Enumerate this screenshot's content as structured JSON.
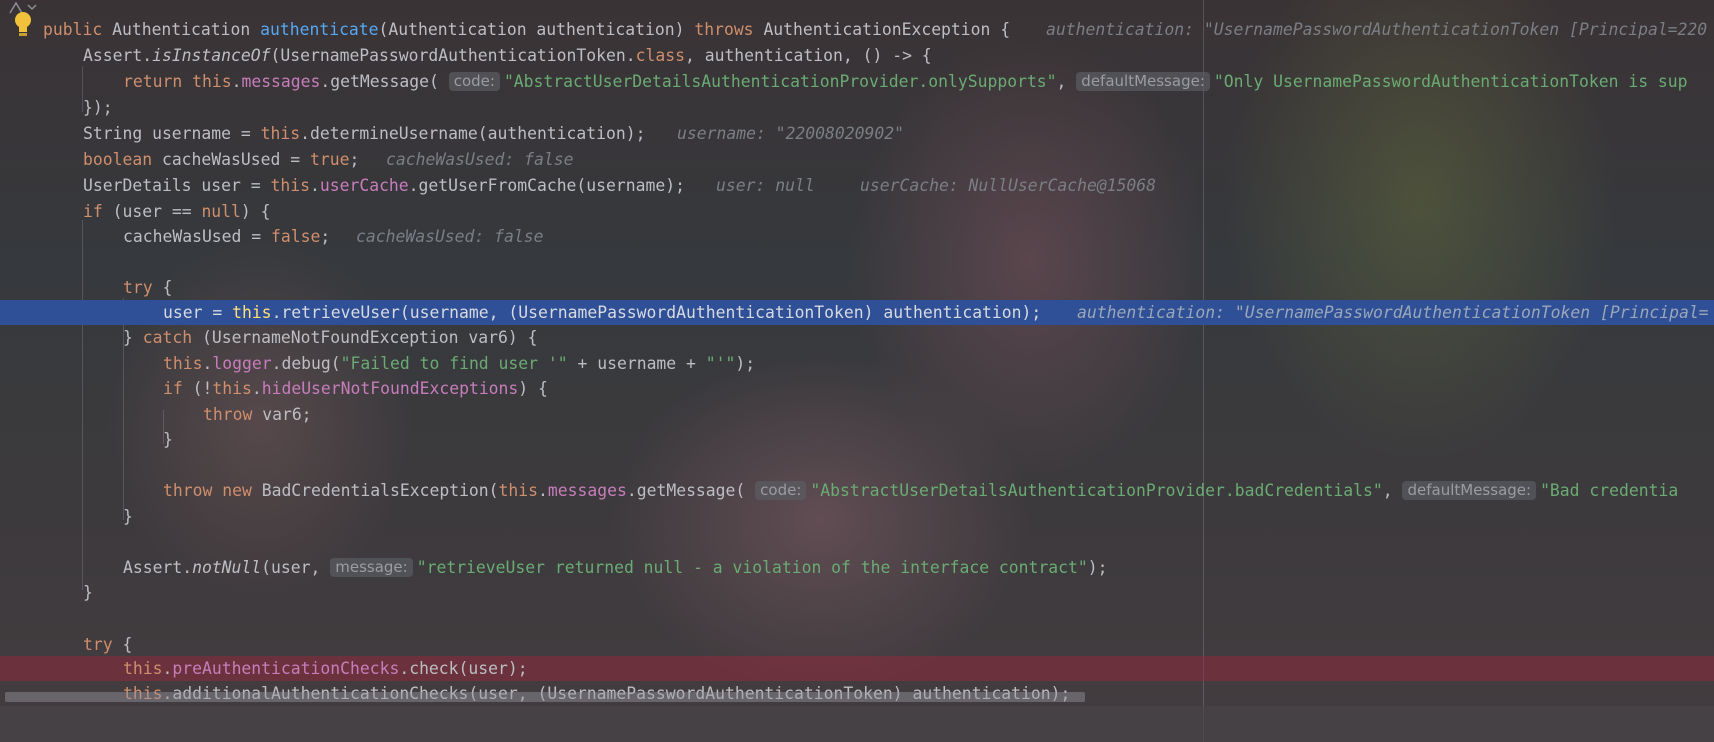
{
  "editor": {
    "code": {
      "l1": {
        "public": "public",
        "type": "Authentication",
        "method": "authenticate",
        "params": "(Authentication authentication)",
        "throws": "throws",
        "exc": "AuthenticationException {",
        "hint": "authentication: \"UsernamePasswordAuthenticationToken [Principal=220"
      },
      "l2": {
        "a": "Assert.",
        "b": "isInstanceOf",
        "c": "(UsernamePasswordAuthenticationToken.",
        "d": "class",
        "e": ", authentication, () -> {"
      },
      "l3": {
        "ret": "return",
        "this": "this",
        "dot": ".",
        "fld": "messages",
        "m": ".getMessage(",
        "p1": "code:",
        "s1": "\"AbstractUserDetailsAuthenticationProvider.onlySupports\"",
        "c": ",",
        "p2": "defaultMessage:",
        "s2": "\"Only UsernamePasswordAuthenticationToken is sup"
      },
      "l4": {
        "t": "});"
      },
      "l5": {
        "a": "String username = ",
        "this": "this",
        "b": ".determineUsername(authentication);",
        "hint": "username: \"22008020902\""
      },
      "l6": {
        "kw": "boolean",
        "a": " cacheWasUsed = ",
        "v": "true",
        "b": ";",
        "hint": "cacheWasUsed: false"
      },
      "l7": {
        "a": "UserDetails user = ",
        "this": "this",
        "dot": ".",
        "fld": "userCache",
        "b": ".getUserFromCache(username);",
        "hint1": "user: null",
        "hint2": "userCache: NullUserCache@15068"
      },
      "l8": {
        "kw": "if",
        "a": " (user == ",
        "v": "null",
        "b": ") {"
      },
      "l9": {
        "a": "cacheWasUsed = ",
        "v": "false",
        "b": ";",
        "hint": "cacheWasUsed: false"
      },
      "l10": {
        "kw": "try",
        "b": " {"
      },
      "l11": {
        "a": "user = ",
        "this": "this",
        "b": ".retrieveUser(username, (UsernamePasswordAuthenticationToken) authentication);",
        "hint": "authentication: \"UsernamePasswordAuthenticationToken [Principal="
      },
      "l12": {
        "a": "} ",
        "kw": "catch",
        "b": " (UsernameNotFoundException var6) {"
      },
      "l13": {
        "this": "this",
        "dot": ".",
        "fld": "logger",
        "a": ".debug(",
        "s1": "\"Failed to find user '\"",
        "b": " + username + ",
        "s2": "\"'\"",
        "c": ");"
      },
      "l14": {
        "kw": "if",
        "a": " (!",
        "this": "this",
        "dot": ".",
        "fld": "hideUserNotFoundExceptions",
        "b": ") {"
      },
      "l15": {
        "kw": "throw",
        "a": " var6;"
      },
      "l16": {
        "t": "}"
      },
      "l17": {
        "kw1": "throw",
        "kw2": "new",
        "a": "BadCredentialsException(",
        "this": "this",
        "dot": ".",
        "fld": "messages",
        "b": ".getMessage(",
        "p1": "code:",
        "s1": "\"AbstractUserDetailsAuthenticationProvider.badCredentials\"",
        "c": ",",
        "p2": "defaultMessage:",
        "s2": "\"Bad credentia"
      },
      "l18": {
        "t": "}"
      },
      "l19": {
        "a": "Assert.",
        "b": "notNull",
        "c": "(user,",
        "p1": "message:",
        "s1": "\"retrieveUser returned null - a violation of the interface contract\"",
        "d": ");"
      },
      "l20": {
        "t": "}"
      },
      "l21": {
        "kw": "try",
        "b": " {"
      },
      "l22": {
        "this": "this",
        "dot": ".",
        "fld": "preAuthenticationChecks",
        "b": ".check(user);"
      },
      "l23": {
        "this": "this",
        "b": ".additionalAuthenticationChecks(user, (UsernamePasswordAuthenticationToken) authentication);"
      }
    }
  },
  "colors": {
    "execution_line": "#2f4f96",
    "error_line": "#96283c",
    "keyword": "#cf8e6d",
    "string": "#6aab73",
    "field": "#c77dbb",
    "method": "#56a8f5"
  },
  "icons": {
    "bulb": "lightbulb-icon",
    "gutter": "debug-arrow-icon"
  }
}
